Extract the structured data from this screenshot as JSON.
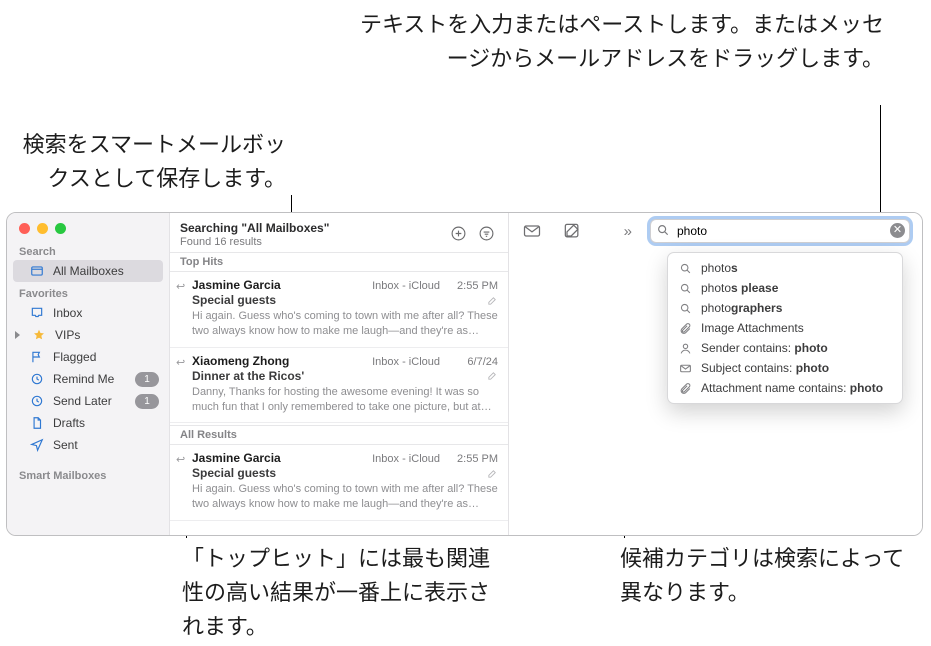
{
  "callouts": {
    "top_right": "テキストを入力またはペーストします。またはメッセージからメールアドレスをドラッグします。",
    "top_left": "検索をスマートメールボックスとして保存します。",
    "bottom_left": "「トップヒット」には最も関連性の高い結果が一番上に表示されます。",
    "bottom_right": "候補カテゴリは検索によって異なります。"
  },
  "sidebar": {
    "search_heading": "Search",
    "all_mailboxes": "All Mailboxes",
    "favorites_heading": "Favorites",
    "items": [
      {
        "label": "Inbox",
        "icon": "inbox"
      },
      {
        "label": "VIPs",
        "icon": "star"
      },
      {
        "label": "Flagged",
        "icon": "flag"
      },
      {
        "label": "Remind Me",
        "icon": "clock",
        "badge": "1"
      },
      {
        "label": "Send Later",
        "icon": "clock-send",
        "badge": "1"
      },
      {
        "label": "Drafts",
        "icon": "doc"
      },
      {
        "label": "Sent",
        "icon": "paperplane"
      }
    ],
    "smart_heading": "Smart Mailboxes"
  },
  "list": {
    "title": "Searching \"All Mailboxes\"",
    "subtitle": "Found 16 results",
    "top_hits_label": "Top Hits",
    "all_results_label": "All Results",
    "messages": [
      {
        "from": "Jasmine Garcia",
        "mailbox": "Inbox - iCloud",
        "date": "2:55 PM",
        "subject": "Special guests",
        "preview": "Hi again. Guess who's coming to town with me after all? These two always know how to make me laugh—and they're as insepa..."
      },
      {
        "from": "Xiaomeng Zhong",
        "mailbox": "Inbox - iCloud",
        "date": "6/7/24",
        "subject": "Dinner at the Ricos'",
        "preview": "Danny, Thanks for hosting the awesome evening! It was so much fun that I only remembered to take one picture, but at least it's a good..."
      }
    ],
    "all_messages": [
      {
        "from": "Jasmine Garcia",
        "mailbox": "Inbox - iCloud",
        "date": "2:55 PM",
        "subject": "Special guests",
        "preview": "Hi again. Guess who's coming to town with me after all? These two always know how to make me laugh—and they're as insepa..."
      }
    ]
  },
  "search": {
    "value": "photo",
    "suggestions_text": [
      {
        "icon": "mag",
        "pre": "photo",
        "bold": "s"
      },
      {
        "icon": "mag",
        "pre": "photo",
        "bold": "s please"
      },
      {
        "icon": "mag",
        "pre": "photo",
        "bold": "graphers"
      }
    ],
    "suggestions_cat": [
      {
        "icon": "clip",
        "label": "Image Attachments"
      },
      {
        "icon": "person",
        "label": "Sender contains: ",
        "bold": "photo"
      },
      {
        "icon": "envelope",
        "label": "Subject contains: ",
        "bold": "photo"
      },
      {
        "icon": "clip",
        "label": "Attachment name contains: ",
        "bold": "photo"
      }
    ]
  }
}
